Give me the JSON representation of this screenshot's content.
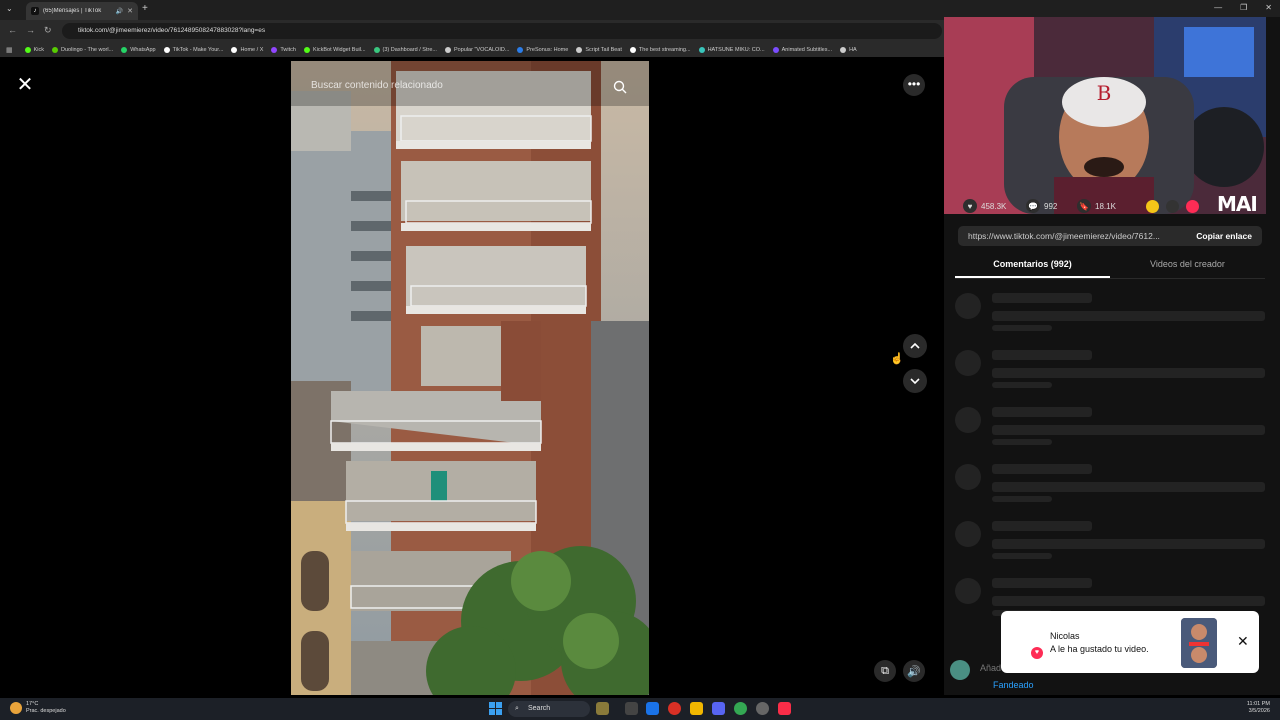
{
  "browser": {
    "tab_title": "(65)Mensajes | TikTok",
    "url": "tiktok.com/@jimeemierez/video/7612489508247883028?lang=es",
    "bookmarks": [
      {
        "label": "Kick",
        "color": "#53fc18"
      },
      {
        "label": "Duolingo - The worl...",
        "color": "#58cc02"
      },
      {
        "label": "WhatsApp",
        "color": "#25d366"
      },
      {
        "label": "TikTok - Make Your...",
        "color": "#ffffff"
      },
      {
        "label": "Home / X",
        "color": "#ffffff"
      },
      {
        "label": "Twitch",
        "color": "#9146ff"
      },
      {
        "label": "KickBot Widget Buil...",
        "color": "#53fc18"
      },
      {
        "label": "(3) Dashboard / Stre...",
        "color": "#3ac77f"
      },
      {
        "label": "Popular \"VOCALOID...",
        "color": "#cccccc"
      },
      {
        "label": "PreSonus: Home",
        "color": "#2b7de9"
      },
      {
        "label": "Script Tail Beat",
        "color": "#cccccc"
      },
      {
        "label": "The best streaming...",
        "color": "#ffffff"
      },
      {
        "label": "HATSUNE MIKU: CO...",
        "color": "#39c5bb"
      },
      {
        "label": "Animated Subtitles...",
        "color": "#7b4dff"
      },
      {
        "label": "HA",
        "color": "#cccccc"
      }
    ]
  },
  "video": {
    "search_placeholder": "Buscar contenido relacionado"
  },
  "panel": {
    "likes": "458.3K",
    "comments": "992",
    "saves": "18.1K",
    "link": "https://www.tiktok.com/@jimeemierez/video/7612...",
    "copy_label": "Copiar enlace",
    "tab_comments": "Comentarios (992)",
    "tab_creator": "Videos del creador",
    "overlay_text": "MAI",
    "composer_placeholder": "Añad",
    "composer_user": "Fandeado"
  },
  "notification": {
    "name": "Nicolas",
    "message": "A le ha gustado tu video."
  },
  "taskbar": {
    "temp": "17°C",
    "weather": "Prac. despejado",
    "search": "Search",
    "time": "11:01 PM",
    "date": "3/5/2026"
  },
  "colors": {
    "accent": "#fe2c55",
    "link_blue": "#2aa1ff",
    "panel_bg": "#121212"
  }
}
